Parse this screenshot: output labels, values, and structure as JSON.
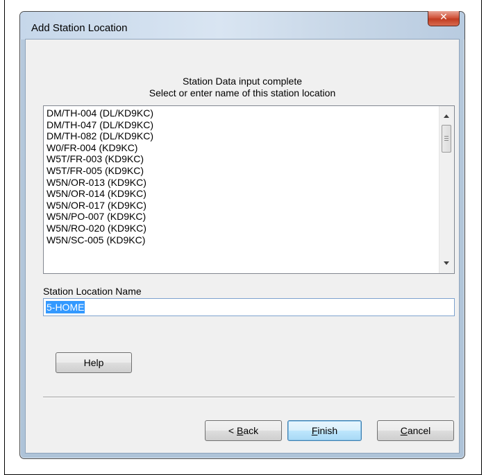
{
  "window": {
    "title": "Add Station Location",
    "close_glyph": "✕"
  },
  "header": {
    "line1": "Station Data input complete",
    "line2": "Select or enter name of this station location"
  },
  "locations": [
    "DM/TH-004 (DL/KD9KC)",
    "DM/TH-047 (DL/KD9KC)",
    "DM/TH-082 (DL/KD9KC)",
    "W0/FR-004 (KD9KC)",
    "W5T/FR-003 (KD9KC)",
    "W5T/FR-005 (KD9KC)",
    "W5N/OR-013 (KD9KC)",
    "W5N/OR-014 (KD9KC)",
    "W5N/OR-017 (KD9KC)",
    "W5N/PO-007 (KD9KC)",
    "W5N/RO-020 (KD9KC)",
    "W5N/SC-005 (KD9KC)"
  ],
  "station_field": {
    "label": "Station Location Name",
    "value": "5-HOME"
  },
  "buttons": {
    "help": "Help",
    "back_prefix": "< ",
    "back_mnemonic": "B",
    "back_rest": "ack",
    "finish_mnemonic": "F",
    "finish_rest": "inish",
    "cancel_mnemonic": "C",
    "cancel_rest": "ancel"
  }
}
